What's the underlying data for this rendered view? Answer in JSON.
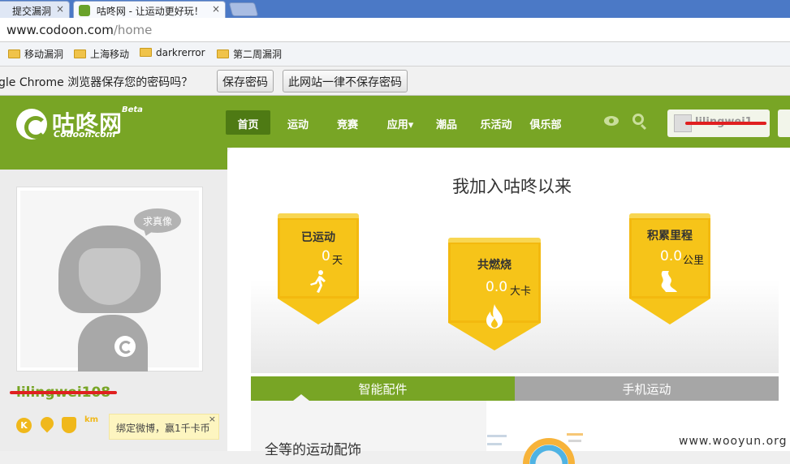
{
  "browser": {
    "tabs": [
      {
        "title": "提交漏洞",
        "close": "×"
      },
      {
        "title": "咕咚网 - 让运动更好玩！",
        "close": "×"
      }
    ],
    "url_host": "www.codoon.com",
    "url_path": "/home",
    "bookmarks": [
      "移动漏洞",
      "上海移动",
      "darkrerror",
      "第二周漏洞"
    ],
    "password_prompt": "gle Chrome 浏览器保存您的密码吗？",
    "save_password": "保存密码",
    "never_save": "此网站一律不保存密码"
  },
  "site": {
    "logo_text": "咕咚网",
    "logo_sub": "Codoon.com",
    "beta": "Beta",
    "nav": [
      "首页",
      "运动",
      "竞赛",
      "应用▾",
      "潮品",
      "乐活动",
      "俱乐部"
    ],
    "user_name": "lilingwei1..."
  },
  "profile": {
    "bubble": "求真像",
    "username": "lilingwei108",
    "badge_k": "K",
    "badge_km": "km",
    "weibo": "绑定微博，赢1千卡币",
    "weibo_close": "×"
  },
  "stats": {
    "heading": "我加入咕咚以来",
    "exercised": {
      "title": "已运动",
      "value": "0",
      "unit": "天"
    },
    "burned": {
      "title": "共燃烧",
      "value": "0.0",
      "unit": "大卡"
    },
    "distance": {
      "title": "积累里程",
      "value": "0.0",
      "unit": "公里"
    }
  },
  "tabs": {
    "smart": "智能配件",
    "phone": "手机运动"
  },
  "content": {
    "title": "全等的运动配饰"
  },
  "watermark": "www.wooyun.org",
  "colors": {
    "brand_green": "#78a525",
    "card_yellow": "#f6c419",
    "tab_gray": "#a6a6a6"
  }
}
